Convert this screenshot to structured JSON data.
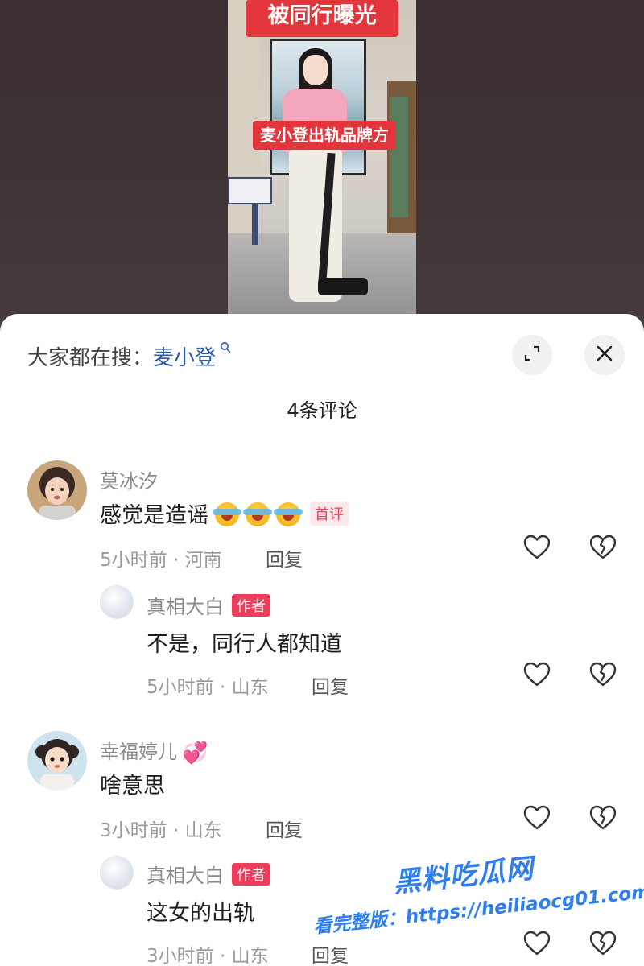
{
  "video": {
    "banner_top": "被同行曝光",
    "banner_mid": "麦小登出轨品牌方"
  },
  "sheet": {
    "search_prefix": "大家都在搜：",
    "search_keyword": "麦小登",
    "comment_count_title": "4条评论"
  },
  "comments": [
    {
      "username": "莫冰汐",
      "text": "感觉是造谣",
      "badge": "首评",
      "meta": "5小时前 · 河南",
      "reply_label": "回复",
      "reply": {
        "username": "真相大白",
        "badge": "作者",
        "text": "不是，同行人都知道",
        "meta": "5小时前 · 山东",
        "reply_label": "回复"
      }
    },
    {
      "username": "幸福婷儿",
      "text": "啥意思",
      "meta": "3小时前 · 山东",
      "reply_label": "回复",
      "reply": {
        "username": "真相大白",
        "badge": "作者",
        "text": "这女的出轨",
        "meta": "3小时前 · 山东",
        "reply_label": "回复"
      }
    }
  ],
  "watermark": {
    "title": "黑料吃瓜网",
    "url": "看完整版：https://heiliaocg01.com"
  },
  "colors": {
    "accent_red": "#e2363c",
    "author_badge": "#ee3d5a",
    "search_keyword": "#2b5aa8",
    "watermark_blue": "#2f7ef0"
  }
}
